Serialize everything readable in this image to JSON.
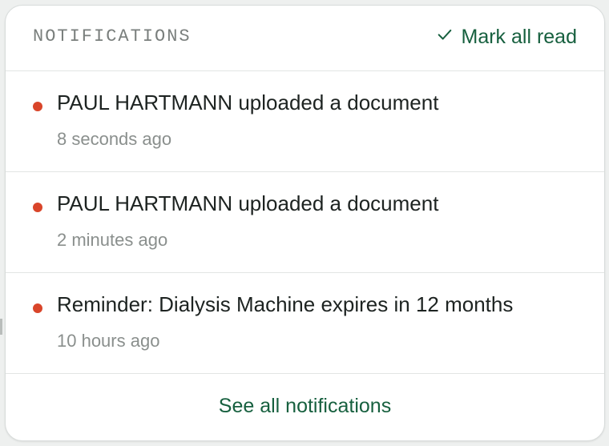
{
  "header": {
    "title": "NOTIFICATIONS",
    "mark_all_label": "Mark all read",
    "mark_all_icon": "check-icon"
  },
  "notifications": [
    {
      "title": "PAUL HARTMANN uploaded a document",
      "time": "8 seconds ago",
      "unread": true
    },
    {
      "title": "PAUL HARTMANN uploaded a document",
      "time": "2 minutes ago",
      "unread": true
    },
    {
      "title": "Reminder: Dialysis Machine expires in 12 months",
      "time": "10 hours ago",
      "unread": true
    }
  ],
  "footer": {
    "see_all_label": "See all notifications"
  },
  "colors": {
    "accent": "#17603f",
    "unread_dot": "#d9452a",
    "muted_text": "#8a8f8d"
  }
}
